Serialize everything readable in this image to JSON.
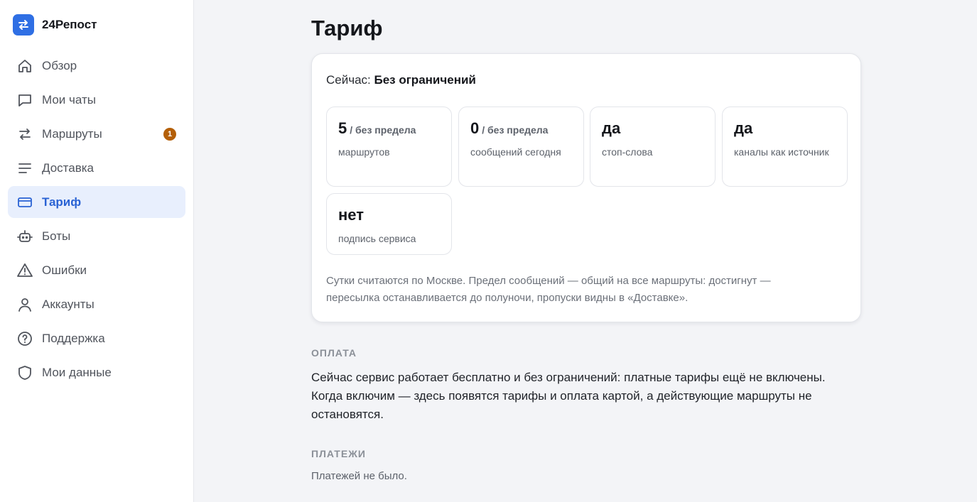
{
  "app": {
    "name": "24Репост",
    "accent": "#2f6fe4"
  },
  "sidebar": {
    "items": [
      {
        "label": "Обзор",
        "icon": "home-icon",
        "active": false
      },
      {
        "label": "Мои чаты",
        "icon": "chat-icon",
        "active": false
      },
      {
        "label": "Маршруты",
        "icon": "arrows-icon",
        "active": false,
        "badge": "1"
      },
      {
        "label": "Доставка",
        "icon": "lines-icon",
        "active": false
      },
      {
        "label": "Тариф",
        "icon": "card-icon",
        "active": true
      },
      {
        "label": "Боты",
        "icon": "robot-icon",
        "active": false
      },
      {
        "label": "Ошибки",
        "icon": "warning-icon",
        "active": false
      },
      {
        "label": "Аккаунты",
        "icon": "user-icon",
        "active": false
      },
      {
        "label": "Поддержка",
        "icon": "help-icon",
        "active": false
      },
      {
        "label": "Мои данные",
        "icon": "shield-icon",
        "active": false
      }
    ]
  },
  "page": {
    "title": "Тариф"
  },
  "plan": {
    "current_prefix": "Сейчас:",
    "current_value": "Без ограничений",
    "stats": [
      {
        "value": "5",
        "suffix": "/ без предела",
        "label": "маршрутов"
      },
      {
        "value": "0",
        "suffix": "/ без предела",
        "label": "сообщений сегодня"
      },
      {
        "value": "да",
        "suffix": "",
        "label": "стоп-слова"
      },
      {
        "value": "да",
        "suffix": "",
        "label": "каналы как источник"
      },
      {
        "value": "нет",
        "suffix": "",
        "label": "подпись сервиса"
      }
    ],
    "note": "Сутки считаются по Москве. Предел сообщений — общий на все маршруты: достигнут — пересылка останавливается до полуночи, пропуски видны в «Доставке»."
  },
  "payment": {
    "heading": "ОПЛАТА",
    "text": "Сейчас сервис работает бесплатно и без ограничений: платные тарифы ещё не включены. Когда включим — здесь появятся тарифы и оплата картой, а действующие маршруты не остановятся."
  },
  "payments": {
    "heading": "ПЛАТЕЖИ",
    "text": "Платежей не было."
  }
}
